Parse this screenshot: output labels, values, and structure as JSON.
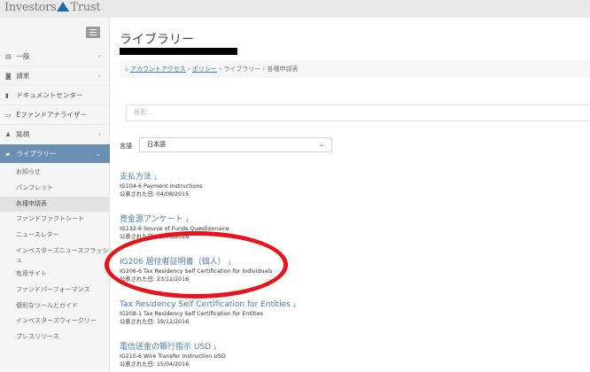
{
  "header": {
    "logo_left": "Investors",
    "logo_right": "Trust"
  },
  "sidebar": {
    "items": [
      {
        "label": "一般",
        "icon": "list-icon",
        "glyph": "▤"
      },
      {
        "label": "請求",
        "icon": "camera-icon",
        "glyph": "◙"
      },
      {
        "label": "ドキュメントセンター",
        "icon": "file-icon",
        "glyph": "▮"
      },
      {
        "label": "Eファンドアナライザー",
        "icon": "monitor-icon",
        "glyph": "▭"
      },
      {
        "label": "銘柄",
        "icon": "users-icon",
        "glyph": "♟"
      },
      {
        "label": "ライブラリー",
        "icon": "book-icon",
        "glyph": "▰"
      }
    ],
    "library_subitems": [
      "お知らせ",
      "パンフレット",
      "各種申請表",
      "ファンドファクトシート",
      "ニュースレター",
      "インベスターズニュースフラッシュ",
      "有用サイト",
      "ファンドパーフォーマンス",
      "便利なツールとガイド",
      "インベスターズウィークリー",
      "プレスリリース"
    ]
  },
  "main": {
    "title": "ライブラリー",
    "breadcrumb": {
      "account_access": "アカウントアクセス",
      "policy": "ポリシー",
      "library": "ライブラリー",
      "forms": "各種申請表",
      "sep": "›"
    },
    "search_placeholder": "検索...",
    "language_label": "言語",
    "language_value": "日本語"
  },
  "documents": [
    {
      "title": "支払方法",
      "code": "IG104-6 Payment Instructions",
      "date": "公表された日: 04/08/2015"
    },
    {
      "title": "資金源アンケート",
      "code": "IG132-6 Source of Funds Questionnaire",
      "date": "公表された日: 03/03/2016"
    },
    {
      "title": "IG206 居住者証明書（個人）",
      "code": "IG206-6 Tax Residency Self Certification for Individuals",
      "date": "公表された日: 23/12/2016"
    },
    {
      "title": "Tax Residency Self Certification for Entities",
      "code": "IG208-1 Tax Residency Self Certification for Entities",
      "date": "公表された日: 19/12/2016"
    },
    {
      "title": "電信送金の銀行指示 USD",
      "code": "IG210-6 Wire Transfer Instruction USD",
      "date": "公表された日: 15/04/2016"
    }
  ],
  "colors": {
    "accent": "#6a8fb2",
    "link": "#4a7fad",
    "annotation": "#e8141b"
  }
}
